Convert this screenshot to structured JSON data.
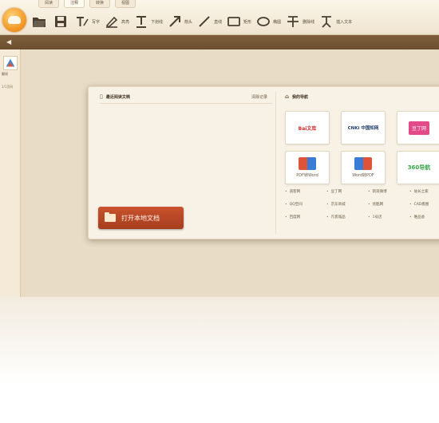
{
  "tabs": [
    "阅读",
    "注释",
    "转换",
    "视图"
  ],
  "tools": [
    {
      "name": "open-file",
      "label": ""
    },
    {
      "name": "save",
      "label": ""
    },
    {
      "name": "text",
      "label": "写字"
    },
    {
      "name": "highlight",
      "label": "高亮"
    },
    {
      "name": "underline",
      "label": "下划线"
    },
    {
      "name": "arrow",
      "label": "箭头"
    },
    {
      "name": "line",
      "label": "直线"
    },
    {
      "name": "rectangle",
      "label": "矩形"
    },
    {
      "name": "ellipse",
      "label": "椭圆"
    },
    {
      "name": "strikeout",
      "label": "删除线"
    },
    {
      "name": "insert-text",
      "label": "插入文本"
    }
  ],
  "rail": {
    "thumb_label": "翻阅",
    "page_label": "1/1页码"
  },
  "recent": {
    "title": "最近阅读文档",
    "clear_label": "清除记录"
  },
  "nav": {
    "title": "我的导航"
  },
  "open_button": "打开本地文档",
  "tiles": [
    {
      "label": "Bai文库"
    },
    {
      "label": "CNKi 中国知网"
    },
    {
      "label": "豆丁网"
    },
    {
      "label": "PDF转Word"
    },
    {
      "label": "Word转PDF"
    },
    {
      "label": "360导航"
    }
  ],
  "links": [
    [
      "道客网",
      "豆丁网",
      "新浪微博",
      "站长之家"
    ],
    [
      "QQ空间",
      "京东商城",
      "优酷网",
      "CAD看图"
    ],
    [
      "百度网",
      "凡客诚品",
      "1号店",
      "唯品会"
    ]
  ]
}
